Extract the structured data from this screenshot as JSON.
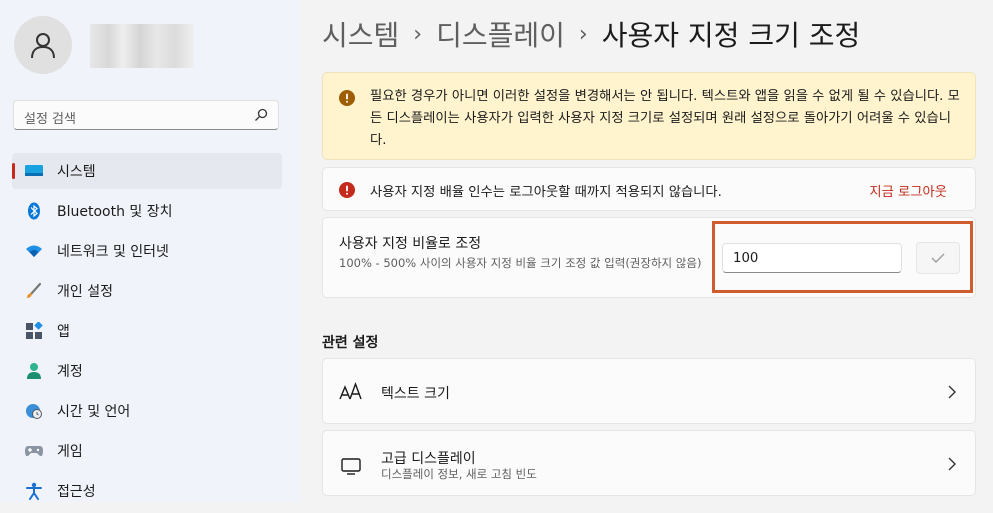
{
  "sidebar": {
    "search_placeholder": "설정 검색",
    "items": [
      {
        "label": "시스템",
        "icon": "monitor-icon"
      },
      {
        "label": "Bluetooth 및 장치",
        "icon": "bluetooth-icon"
      },
      {
        "label": "네트워크 및 인터넷",
        "icon": "wifi-icon"
      },
      {
        "label": "개인 설정",
        "icon": "brush-icon"
      },
      {
        "label": "앱",
        "icon": "apps-icon"
      },
      {
        "label": "계정",
        "icon": "account-icon"
      },
      {
        "label": "시간 및 언어",
        "icon": "globe-clock-icon"
      },
      {
        "label": "게임",
        "icon": "gamepad-icon"
      },
      {
        "label": "접근성",
        "icon": "accessibility-icon"
      }
    ]
  },
  "breadcrumb": {
    "part1": "시스템",
    "part2": "디스플레이",
    "current": "사용자 지정 크기 조정",
    "separator": "›"
  },
  "warning": {
    "text": "필요한 경우가 아니면 이러한 설정을 변경해서는 안 됩니다. 텍스트와 앱을 읽을 수 없게 될 수 있습니다. 모든 디스플레이는 사용자가 입력한 사용자 지정 크기로 설정되며 원래 설정으로 돌아가기 어려울 수 있습니다."
  },
  "error": {
    "text": "사용자 지정 배율 인수는 로그아웃할 때까지 적용되지 않습니다.",
    "action": "지금 로그아웃"
  },
  "scale": {
    "title": "사용자 지정 비율로 조정",
    "description": "100% - 500% 사이의 사용자 지정 비율 크기 조정 값 입력(권장하지 않음)",
    "value": "100"
  },
  "related": {
    "title": "관련 설정",
    "text_size": {
      "title": "텍스트 크기"
    },
    "advanced_display": {
      "title": "고급 디스플레이",
      "subtitle": "디스플레이 정보, 새로 고침 빈도"
    }
  },
  "colors": {
    "accent": "#c42b1c",
    "warning_bg": "#fff4ce",
    "highlight": "#cf5c2c"
  }
}
